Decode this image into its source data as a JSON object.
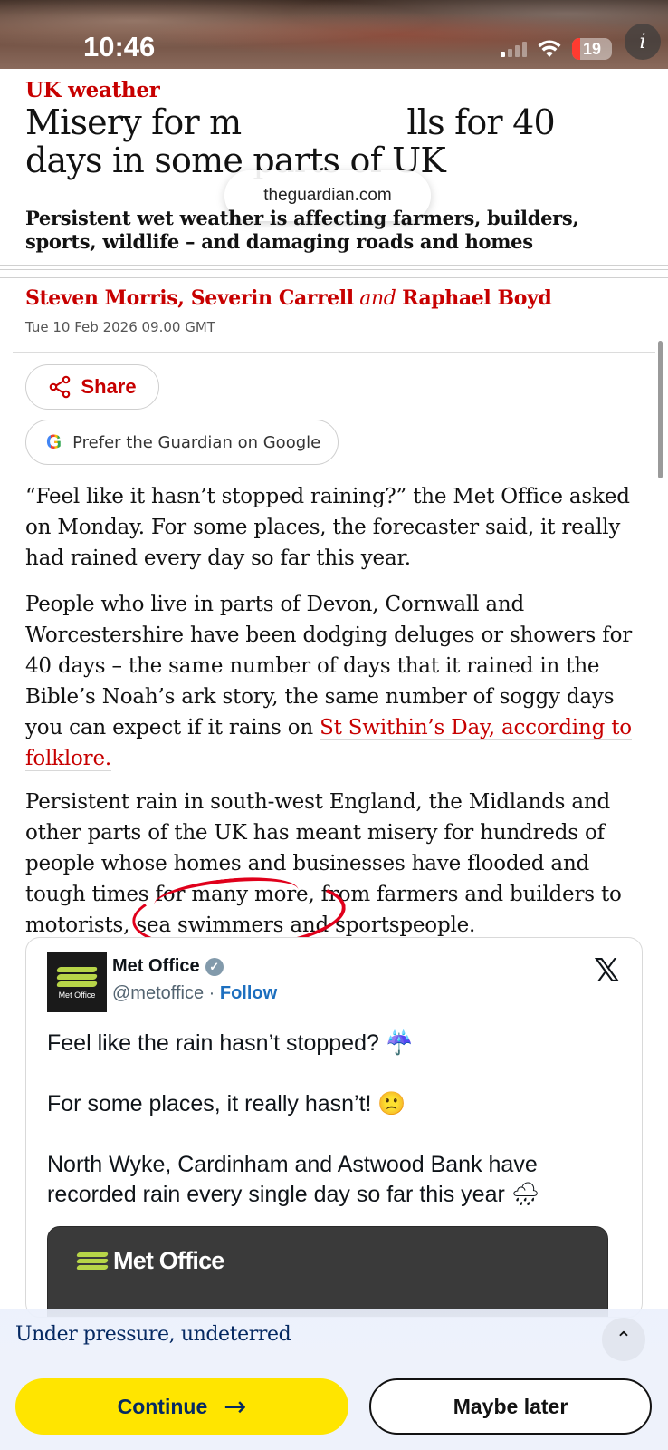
{
  "status_bar": {
    "time": "10:46",
    "battery_level": "19",
    "info_icon": "i"
  },
  "browser": {
    "url": "theguardian.com"
  },
  "article": {
    "kicker": "UK weather",
    "headline_line1_start": "Misery for m",
    "headline_line1_end": "lls for 40",
    "headline_line2": "days in some parts of UK",
    "standfirst": "Persistent wet weather is affecting farmers, builders, sports, wildlife – and damaging roads and homes",
    "byline": {
      "author1": "Steven Morris",
      "sep": ", ",
      "author2": "Severin Carrell",
      "and": " and ",
      "author3": "Raphael Boyd"
    },
    "dateline": "Tue 10 Feb 2026 09.00 GMT",
    "share_label": "Share",
    "google_label": "Prefer the Guardian on Google",
    "p1": "“Feel like it hasn’t stopped raining?” the Met Office asked on Monday. For some places, the forecaster said, it really had rained every day so far this year.",
    "p2_text": "People who live in parts of Devon, Cornwall and Worcestershire have been dodging deluges or showers for 40 days – the same number of days that it rained in the Bible’s Noah’s ark story, the same number of soggy days you can expect if it rains on ",
    "p2_link": "St Swithin’s Day, according to folklore.",
    "p3": "Persistent rain in south-west England, the Midlands and other parts of the UK has meant misery for hundreds of people whose homes and businesses have flooded and tough times for many more, from farmers and builders to motorists, sea swimmers and sportspeople."
  },
  "tweet": {
    "avatar_label": "Met Office",
    "name": "Met Office",
    "verified_mark": "✓",
    "handle": "@metoffice",
    "dot": " · ",
    "follow": "Follow",
    "line1": "Feel like the rain hasn’t stopped? ",
    "line1_emoji": "☔",
    "line2": "For some places, it really hasn’t! ",
    "line2_emoji": "🙁",
    "line3": "North Wyke, Cardinham and Astwood Bank have recorded rain every single day so far this year ",
    "line3_emoji": "🌧",
    "card_brand": "Met Office",
    "x_logo": "𝕏"
  },
  "banner": {
    "title": "Under pressure, undeterred",
    "chevron": "⌃",
    "continue_label": "Continue",
    "continue_arrow": "→",
    "maybe_label": "Maybe later"
  },
  "colors": {
    "guardian_red": "#c70000",
    "guardian_blue": "#052962",
    "cta_yellow": "#ffe500",
    "annotation_red": "#e0001b"
  }
}
